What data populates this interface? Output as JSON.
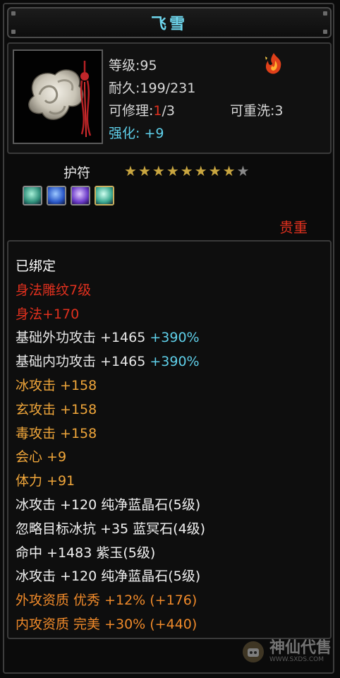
{
  "item": {
    "name": "飞雪",
    "level": "等级:95",
    "durability": {
      "label": "耐久:",
      "value": "199/231"
    },
    "repair": {
      "label": "可修理:",
      "current": "1",
      "max": "/3"
    },
    "rewash": "可重洗:3",
    "enhance": {
      "label": "强化:",
      "value": "+9"
    },
    "type": "护符",
    "stars_filled": 8,
    "stars_total": 9,
    "rarity": "贵重",
    "gems": [
      "green-gem-icon",
      "blue-gem-icon",
      "purple-gem-icon",
      "green-gem-icon"
    ]
  },
  "properties": [
    {
      "text": "已绑定",
      "color": "#ffffff"
    },
    {
      "text": "身法雕纹7级",
      "color": "#e0301e"
    },
    {
      "text": "身法+170",
      "color": "#e0301e"
    },
    {
      "text": "基础外功攻击 +1465",
      "extra": "+390%",
      "color": "#e8e8e8",
      "extra_color": "#5fd0ea"
    },
    {
      "text": "基础内功攻击 +1465",
      "extra": "+390%",
      "color": "#e8e8e8",
      "extra_color": "#5fd0ea"
    },
    {
      "text": "冰攻击 +158",
      "color": "#f0a63a"
    },
    {
      "text": "玄攻击 +158",
      "color": "#f0a63a"
    },
    {
      "text": "毒攻击 +158",
      "color": "#f0a63a"
    },
    {
      "text": "会心 +9",
      "color": "#f0a63a"
    },
    {
      "text": "体力 +91",
      "color": "#f0a63a"
    },
    {
      "text": "冰攻击 +120 纯净蓝晶石(5级)",
      "color": "#f2f2f2"
    },
    {
      "text": "忽略目标冰抗 +35 蓝冥石(4级)",
      "color": "#f2f2f2"
    },
    {
      "text": "命中 +1483 紫玉(5级)",
      "color": "#f2f2f2"
    },
    {
      "text": "冰攻击 +120 纯净蓝晶石(5级)",
      "color": "#f2f2f2"
    },
    {
      "text": "外攻资质  优秀 +12% (+176)",
      "color": "#f08a2a"
    },
    {
      "text": "内攻资质  完美 +30% (+440)",
      "color": "#f08a2a"
    }
  ],
  "watermark": {
    "text": "神仙代售",
    "url": "WWW.SXDS.COM"
  },
  "colors": {
    "title": "#6fd7ee",
    "label": "#d8d8d8",
    "red": "#e0301e",
    "cyan": "#5fd0ea",
    "orange": "#f0a63a",
    "star": "#c9a640"
  }
}
